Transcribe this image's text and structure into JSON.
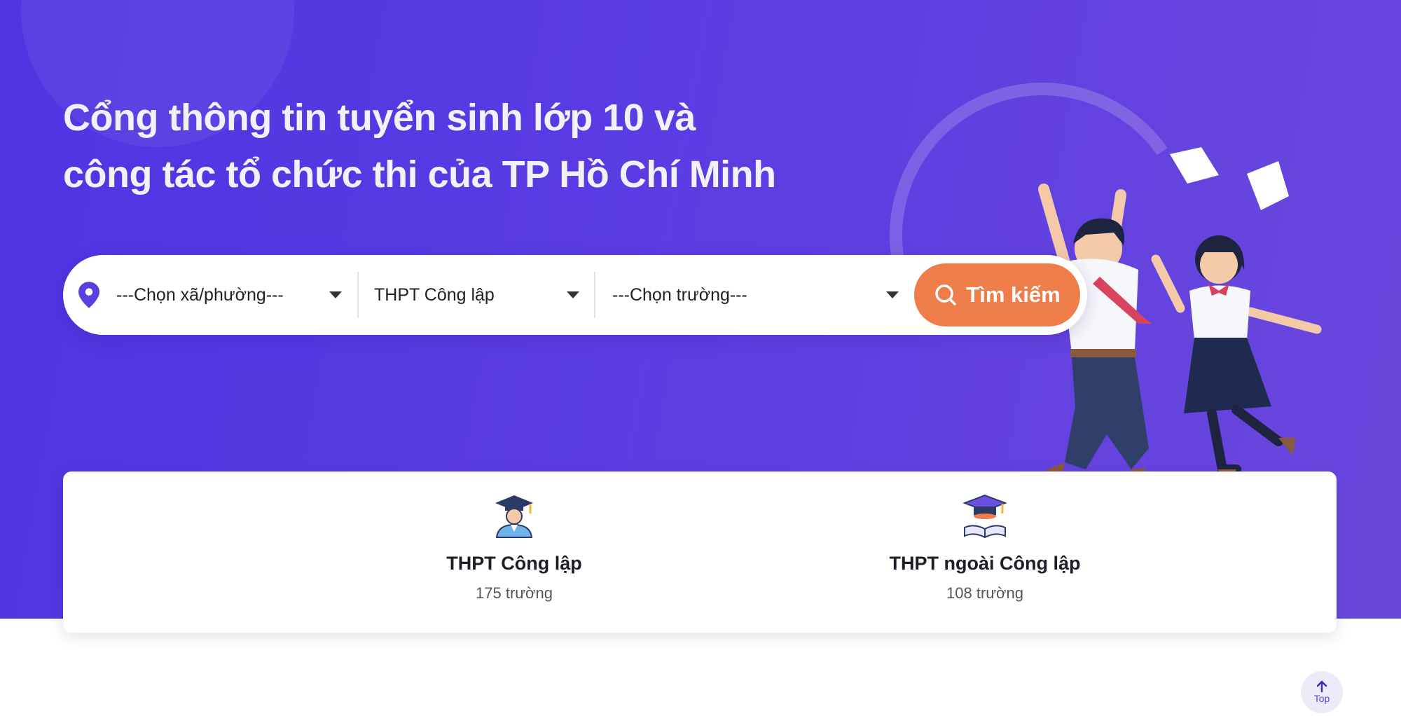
{
  "hero": {
    "title_line1": "Cổng thông tin tuyển sinh lớp 10 và",
    "title_line2": "công tác tổ chức thi của TP Hồ Chí Minh"
  },
  "search": {
    "ward_select": "---Chọn xã/phường---",
    "type_select": "THPT Công lập",
    "school_select": "---Chọn trường---",
    "search_button": "Tìm kiếm"
  },
  "categories": [
    {
      "label": "THPT Công lập",
      "count": "175 trường",
      "icon": "graduate-student-icon"
    },
    {
      "label": "THPT ngoài Công lập",
      "count": "108 trường",
      "icon": "graduation-cap-book-icon"
    }
  ],
  "top_button": "Top",
  "colors": {
    "hero": "#5b3ce3",
    "accent": "#ef7d4a",
    "pin": "#5a3ee0"
  }
}
